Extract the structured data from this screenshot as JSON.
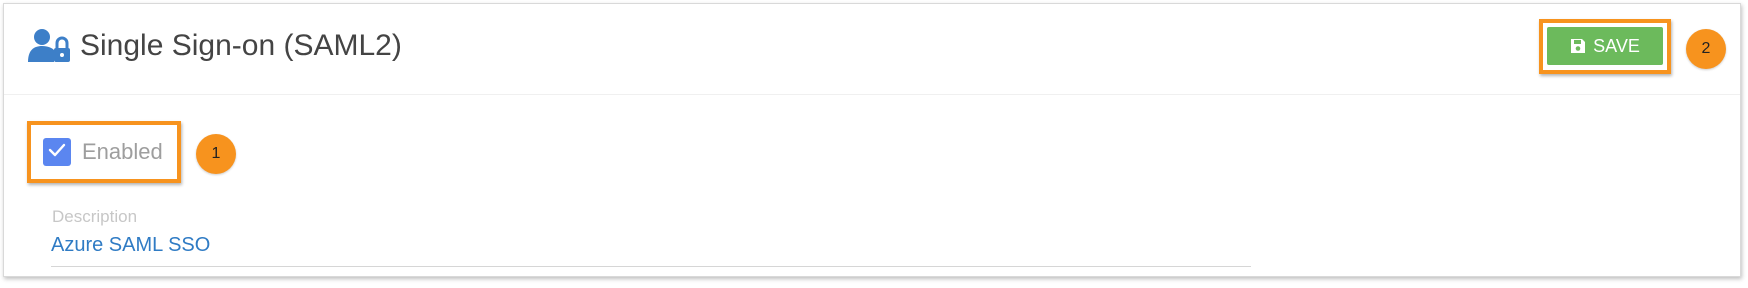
{
  "header": {
    "title": "Single Sign-on (SAML2)",
    "title_icon": "user-lock-icon",
    "save_label": "SAVE",
    "save_icon": "floppy-disk-icon"
  },
  "form": {
    "enabled": {
      "label": "Enabled",
      "checked": true
    },
    "description": {
      "label": "Description",
      "value": "Azure SAML SSO"
    }
  },
  "annotations": {
    "callout_1": "1",
    "callout_2": "2"
  },
  "colors": {
    "save_button": "#6cba5c",
    "checkbox": "#5b86f0",
    "highlight": "#f7931e",
    "icon_blue": "#3d7fc8",
    "link_blue": "#2f7bc4"
  }
}
